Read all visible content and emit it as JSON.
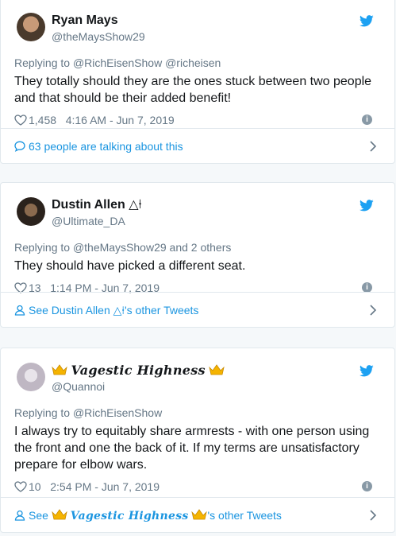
{
  "colors": {
    "accent": "#1da1f2",
    "link": "#1b95e0",
    "muted": "#657786",
    "border": "#e1e8ed"
  },
  "tweets": [
    {
      "name": "Ryan Mays",
      "handle": "@theMaysShow29",
      "replying_prefix": "Replying to",
      "replying_to": "@RichEisenShow @richeisen",
      "text": "They totally should they are the ones stuck between two people and that should be their added benefit!",
      "likes": "1,458",
      "timestamp": "4:16 AM - Jun 7, 2019",
      "footer": "63 people are talking about this"
    },
    {
      "name": "Dustin Allen",
      "name_suffix": "△⍿",
      "handle": "@Ultimate_DA",
      "replying_prefix": "Replying to",
      "replying_to": "@theMaysShow29 and 2 others",
      "text": "They should have picked a different seat.",
      "likes": "13",
      "timestamp": "1:14 PM - Jun 7, 2019",
      "footer_prefix": "See Dustin Allen",
      "footer_suffix": "△⍿'s other Tweets"
    },
    {
      "name": "𝓥𝓪𝓰𝓮𝓼𝓽𝓲𝓬 𝓗𝓲𝓰𝓱𝓷𝓮𝓼𝓼",
      "name_display": "Vagestic Highness",
      "handle": "@Quannoi",
      "replying_prefix": "Replying to",
      "replying_to": "@RichEisenShow",
      "text": "I always try to equitably share armrests - with one person using the front and one the back of it. If my terms are unsatisfactory prepare for elbow wars.",
      "likes": "10",
      "timestamp": "2:54 PM - Jun 7, 2019",
      "footer_prefix": "See",
      "footer_suffix": "'s other Tweets"
    }
  ],
  "icons": {
    "bird": "twitter-bird-icon",
    "heart": "heart-icon",
    "info": "info-icon",
    "chat": "chat-bubble-icon",
    "person": "person-icon",
    "chevron": "chevron-right-icon",
    "crown": "crown-icon"
  }
}
